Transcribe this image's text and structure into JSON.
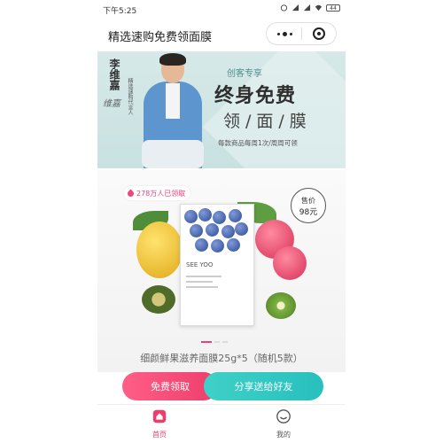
{
  "status_bar": {
    "time": "下午5:25",
    "battery": "44"
  },
  "nav": {
    "title": "精选速购免费领面膜"
  },
  "banner": {
    "name": "李维嘉",
    "role": "精选速购代言人",
    "signature": "维嘉",
    "subtitle": "创客专享",
    "title": "终身免费",
    "title2": "领/面/膜",
    "desc": "每款商品每周1次/周周可领"
  },
  "product": {
    "badge": "278万人已领取",
    "price_label": "售价",
    "price_value": "98元",
    "pack_brand": "SEE YOO",
    "name": "细颜鲜果滋养面膜25g*5（随机5款）"
  },
  "actions": {
    "free_label": "免费领取",
    "share_label": "分享送给好友"
  },
  "tabs": [
    {
      "label": "首页",
      "icon": "home-icon",
      "active": true
    },
    {
      "label": "我的",
      "icon": "smile-icon",
      "active": false
    }
  ],
  "colors": {
    "accent_pink": "#ee3d6c",
    "accent_teal": "#28bfbd",
    "banner_bg": "#d6e9e8"
  }
}
